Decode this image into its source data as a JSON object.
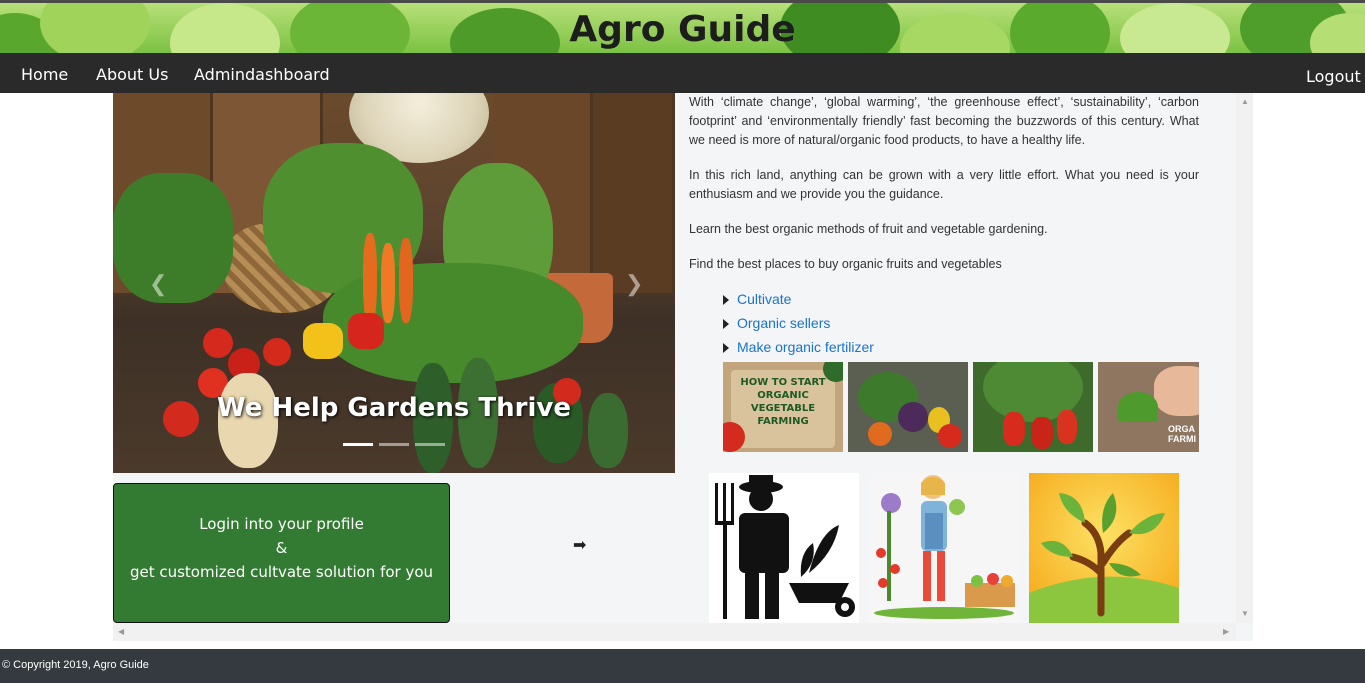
{
  "header": {
    "title": "Agro Guide"
  },
  "nav": {
    "items": [
      {
        "label": "Home"
      },
      {
        "label": "About Us"
      },
      {
        "label": "Admindashboard"
      }
    ],
    "logout": "Logout"
  },
  "carousel": {
    "caption": "We Help Gardens Thrive",
    "indicator_count": 3,
    "active_index": 0
  },
  "login_box": {
    "line1": "Login into your profile",
    "line2": "&",
    "line3": "get customized cultvate solution for you"
  },
  "intro": {
    "paragraphs": [
      "With ‘climate change’, ‘global warming’, ‘the greenhouse effect’, ‘sustainability’, ‘carbon footprint’ and ‘environmentally friendly’ fast becoming the buzzwords of this century. What we need is more of natural/organic food products, to have a healthy life.",
      "In this rich land, anything can be grown with a very little effort. What you need is your enthusiasm and we provide you the guidance.",
      "Learn the best organic methods of fruit and vegetable gardening.",
      "Find the best places to buy organic fruits and vegetables"
    ]
  },
  "links": [
    {
      "label": "Cultivate"
    },
    {
      "label": "Organic sellers"
    },
    {
      "label": "Make organic fertilizer"
    }
  ],
  "thumbnails": {
    "first_text": "HOW TO START ORGANIC VEGETABLE FARMING",
    "last_text": "ORGA FARMI"
  },
  "footer": {
    "text": "© Copyright 2019, Agro Guide"
  },
  "colors": {
    "nav_bg": "#2b2a2a",
    "login_bg": "#337a33",
    "link": "#1a73c9",
    "footer_bg": "#343a40"
  }
}
